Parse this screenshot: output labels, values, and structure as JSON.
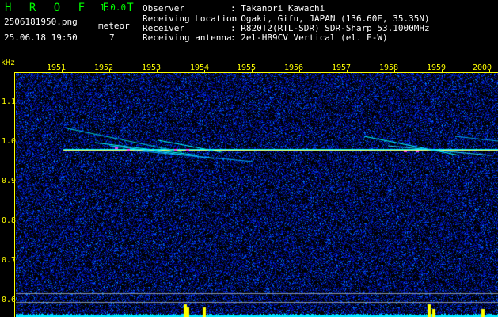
{
  "header": {
    "app_title": "H R O F F T",
    "version": "1.0.0",
    "filename": "2506181950.png",
    "datetime": "25.06.18 19:50",
    "meteor_label": "meteor",
    "meteor_count": "7",
    "info": [
      {
        "key": "Observer",
        "value": ": Takanori Kawachi"
      },
      {
        "key": "Receiving Location",
        "value": ": Ogaki, Gifu, JAPAN (136.60E, 35.35N)"
      },
      {
        "key": "Receiver",
        "value": ": R820T2(RTL-SDR) SDR-Sharp 53.1000MHz"
      },
      {
        "key": "Receiving antenna",
        "value": ": 2el-HB9CV Vertical (el. E-W)"
      }
    ]
  },
  "axis": {
    "unit": "kHz",
    "y_ticks": [
      "1.1",
      "1.0",
      "0.9",
      "0.8",
      "0.7",
      "0.6"
    ],
    "x_ticks": [
      "1951",
      "1952",
      "1953",
      "1954",
      "1955",
      "1956",
      "1957",
      "1958",
      "1959",
      "2000"
    ]
  },
  "colors": {
    "background": "#000000",
    "text": "#ffffff",
    "axis": "#ffff00",
    "logo": "#00ff00",
    "noise": "#1a2bd0",
    "echo_line": "#00ffff",
    "echo_core": "#ff40ff",
    "signal_bar": "#00e5ff"
  }
}
